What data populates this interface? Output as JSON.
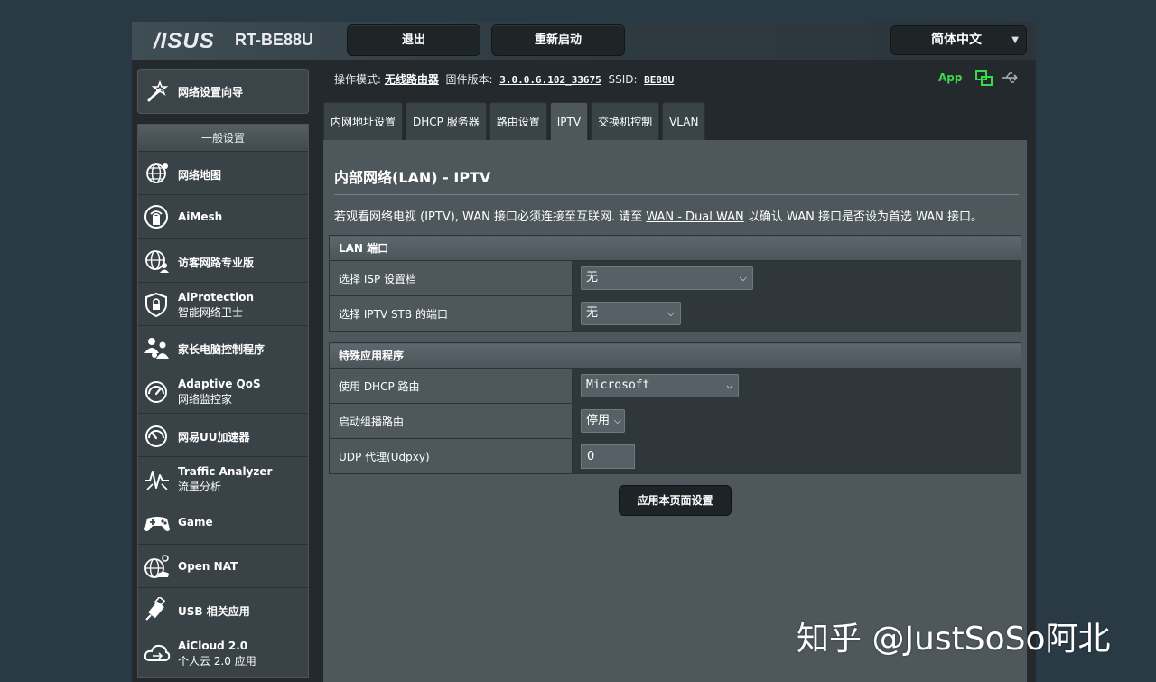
{
  "header": {
    "brand": "/ISUS",
    "model": "RT-BE88U",
    "logout_label": "退出",
    "reboot_label": "重新启动",
    "language": "简体中文"
  },
  "sidebar": {
    "wizard_label": "网络设置向导",
    "group_label": "一般设置",
    "items": [
      {
        "line1": "网络地图",
        "line2": "",
        "icon": "globe-network-icon"
      },
      {
        "line1": "AiMesh",
        "line2": "",
        "icon": "aimesh-icon"
      },
      {
        "line1": "访客网路专业版",
        "line2": "",
        "icon": "guest-network-icon"
      },
      {
        "line1": "AiProtection",
        "line2": "智能网络卫士",
        "icon": "shield-lock-icon"
      },
      {
        "line1": "家长电脑控制程序",
        "line2": "",
        "icon": "parental-control-icon"
      },
      {
        "line1": "Adaptive QoS",
        "line2": "网络监控家",
        "icon": "speedometer-icon"
      },
      {
        "line1": "网易UU加速器",
        "line2": "",
        "icon": "accelerator-icon"
      },
      {
        "line1": "Traffic Analyzer",
        "line2": "流量分析",
        "icon": "traffic-analyzer-icon"
      },
      {
        "line1": "Game",
        "line2": "",
        "icon": "gamepad-icon"
      },
      {
        "line1": "Open NAT",
        "line2": "",
        "icon": "open-nat-icon"
      },
      {
        "line1": "USB 相关应用",
        "line2": "",
        "icon": "usb-app-icon"
      },
      {
        "line1": "AiCloud 2.0",
        "line2": "个人云 2.0 应用",
        "icon": "cloud-icon"
      }
    ]
  },
  "status": {
    "mode_label": "操作模式:",
    "mode_value": "无线路由器",
    "firmware_label": "固件版本:",
    "firmware_value": "3.0.0.6.102_33675",
    "ssid_label": "SSID:",
    "ssid_value": "BE88U",
    "app_label": "App"
  },
  "tabs": [
    {
      "label": "内网地址设置",
      "active": false
    },
    {
      "label": "DHCP 服务器",
      "active": false
    },
    {
      "label": "路由设置",
      "active": false
    },
    {
      "label": "IPTV",
      "active": true
    },
    {
      "label": "交换机控制",
      "active": false
    },
    {
      "label": "VLAN",
      "active": false
    }
  ],
  "main": {
    "title": "内部网络(LAN) - IPTV",
    "desc_before": "若观看网络电视 (IPTV), WAN 接口必须连接至互联网. 请至 ",
    "desc_link": "WAN - Dual WAN",
    "desc_after": " 以确认 WAN 接口是否设为首选 WAN 接口。",
    "lan_section": {
      "title": "LAN 端口",
      "rows": [
        {
          "label": "选择 ISP 设置档",
          "value": "无"
        },
        {
          "label": "选择 IPTV STB 的端口",
          "value": "无"
        }
      ]
    },
    "special_section": {
      "title": "特殊应用程序",
      "rows": [
        {
          "label": "使用 DHCP 路由",
          "value": "Microsoft"
        },
        {
          "label": "启动组播路由",
          "value": "停用"
        },
        {
          "label": "UDP 代理(Udpxy)",
          "value": "0"
        }
      ]
    },
    "apply_label": "应用本页面设置"
  },
  "watermark": "知乎 @JustSoSo阿北",
  "colors": {
    "background": "#2a3a44",
    "panel": "#4d575c",
    "accent_green": "#3cd84c"
  }
}
